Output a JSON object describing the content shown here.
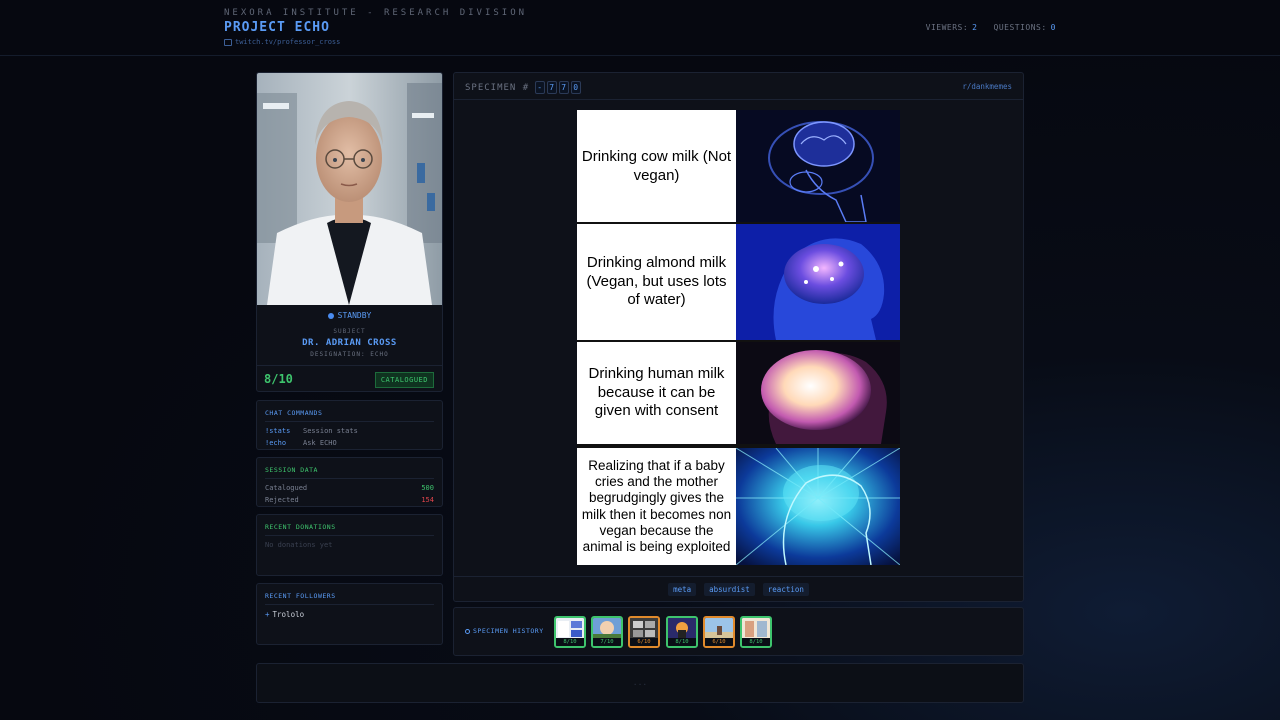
{
  "header": {
    "org": "NEXORA INSTITUTE - RESEARCH DIVISION",
    "project": "PROJECT ECHO",
    "channel": "twitch.tv/professor_cross",
    "viewers_label": "VIEWERS:",
    "viewers": "2",
    "questions_label": "QUESTIONS:",
    "questions": "0"
  },
  "subject": {
    "status": "STANDBY",
    "label": "SUBJECT",
    "name": "DR. ADRIAN CROSS",
    "designation": "DESIGNATION: ECHO",
    "score": "8/10",
    "badge": "CATALOGUED"
  },
  "chat_commands": {
    "title": "CHAT COMMANDS",
    "items": [
      {
        "cmd": "!stats",
        "desc": "Session stats"
      },
      {
        "cmd": "!echo",
        "desc": "Ask ECHO"
      }
    ]
  },
  "session_data": {
    "title": "SESSION DATA",
    "catalogued_label": "Catalogued",
    "catalogued": "500",
    "rejected_label": "Rejected",
    "rejected": "154"
  },
  "donations": {
    "title": "RECENT DONATIONS",
    "empty": "No donations yet"
  },
  "followers": {
    "title": "RECENT FOLLOWERS",
    "items": [
      "Trololo"
    ]
  },
  "specimen": {
    "label": "SPECIMEN #",
    "digits": [
      "-",
      "7",
      "7",
      "0"
    ],
    "subreddit": "r/dankmemes",
    "meme_panels": [
      "Drinking cow milk (Not vegan)",
      "Drinking almond milk (Vegan, but uses lots of water)",
      "Drinking human milk because it can be given with consent",
      "Realizing that if a baby cries and the mother begrudgingly gives the milk then it becomes non vegan because the animal is being exploited"
    ],
    "tags": [
      "meta",
      "absurdist",
      "reaction"
    ]
  },
  "history": {
    "label": "SPECIMEN HISTORY",
    "thumbs": [
      {
        "score": "8/10",
        "border": "#3ec46d"
      },
      {
        "score": "7/10",
        "border": "#3ec46d"
      },
      {
        "score": "6/10",
        "border": "#e08a2c"
      },
      {
        "score": "8/10",
        "border": "#3ec46d"
      },
      {
        "score": "6/10",
        "border": "#e08a2c"
      },
      {
        "score": "8/10",
        "border": "#3ec46d"
      }
    ]
  },
  "footer": {
    "text": "..."
  },
  "colors": {
    "accent": "#5a9bf5",
    "good": "#3ec46d",
    "bad": "#e0454c",
    "warn": "#e08a2c"
  }
}
